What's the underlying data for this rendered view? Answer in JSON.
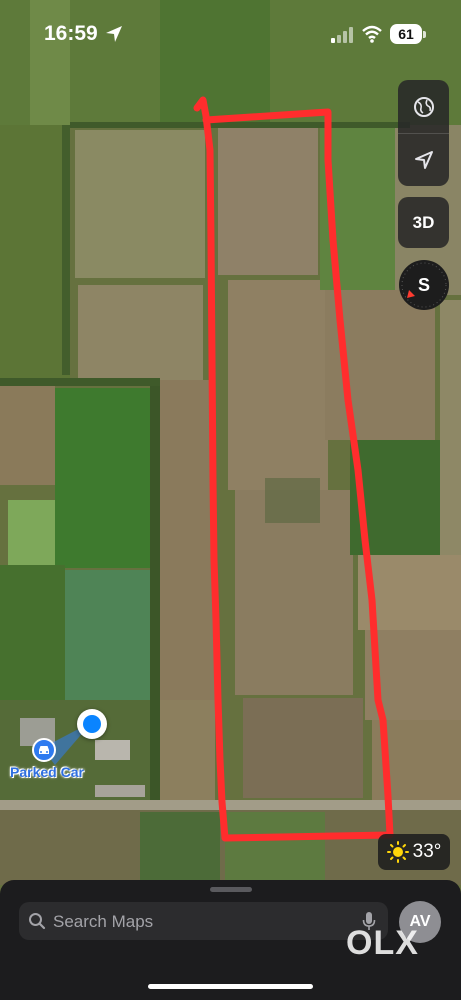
{
  "status_bar": {
    "time": "16:59",
    "battery": "61"
  },
  "map": {
    "parked_car_label": "Parked Car",
    "highlight_color": "#ff2d2d"
  },
  "controls": {
    "globe": "globe-icon",
    "locate": "location-arrow-icon",
    "view_3d": "3D",
    "compass_heading": "S"
  },
  "weather": {
    "temperature": "33°",
    "icon": "sun-icon"
  },
  "search": {
    "placeholder": "Search Maps"
  },
  "profile": {
    "initials": "AV"
  },
  "watermark": "OLX"
}
